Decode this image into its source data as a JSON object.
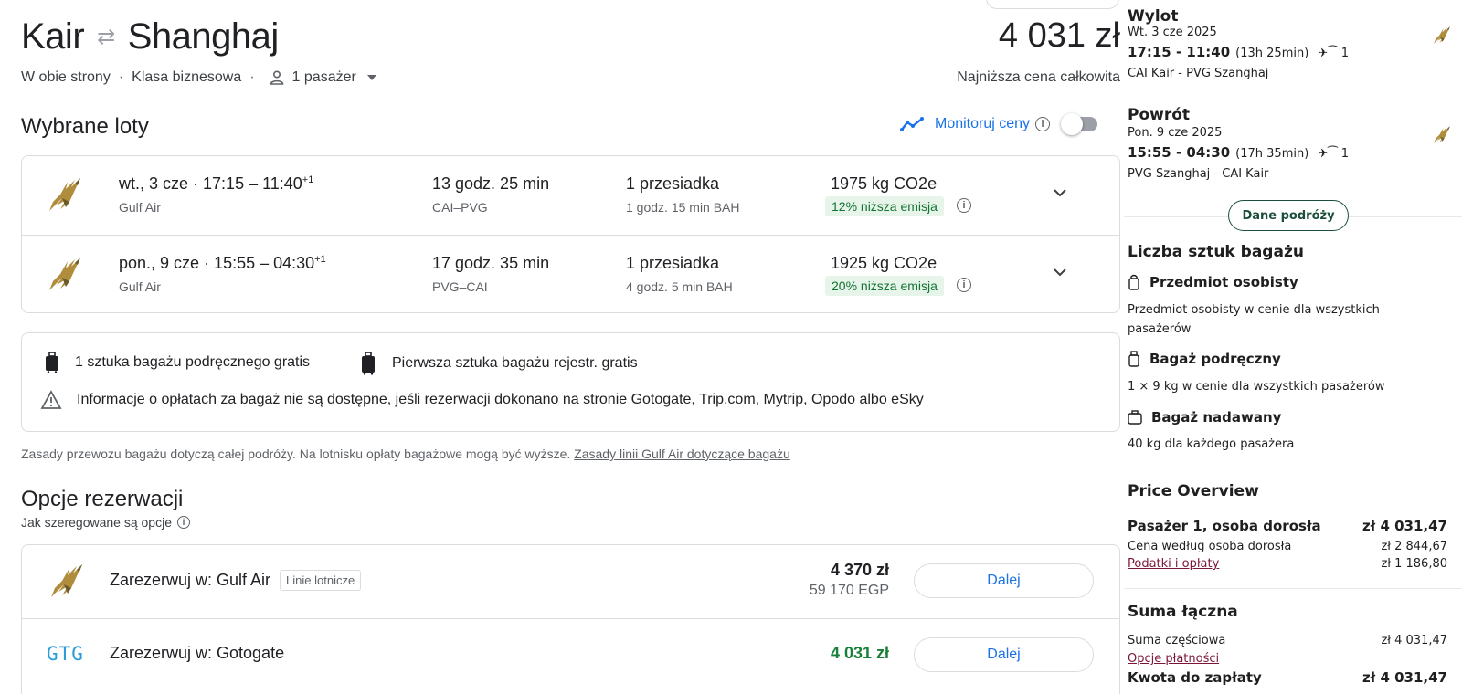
{
  "header": {
    "origin": "Kair",
    "destination": "Shanghaj",
    "total_price": "4 031 zł",
    "total_caption": "Najniższa cena całkowita",
    "trip_type": "W obie strony",
    "cabin": "Klasa biznesowa",
    "passengers": "1 pasażer"
  },
  "selected": {
    "title": "Wybrane loty",
    "monitor_label": "Monitoruj ceny",
    "flights": [
      {
        "date": "wt., 3 cze",
        "times": "17:15 – 11:40",
        "plus_day": "+1",
        "airline": "Gulf Air",
        "duration": "13 godz. 25 min",
        "route": "CAI–PVG",
        "stops": "1 przesiadka",
        "stop_info": "1 godz. 15 min BAH",
        "co2": "1975 kg CO2e",
        "emission": "12% niższa emisja"
      },
      {
        "date": "pon., 9 cze",
        "times": "15:55 – 04:30",
        "plus_day": "+1",
        "airline": "Gulf Air",
        "duration": "17 godz. 35 min",
        "route": "PVG–CAI",
        "stops": "1 przesiadka",
        "stop_info": "4 godz. 5 min BAH",
        "co2": "1925 kg CO2e",
        "emission": "20% niższa emisja"
      }
    ]
  },
  "baggage": {
    "carry_on": "1 sztuka bagażu podręcznego gratis",
    "checked": "Pierwsza sztuka bagażu rejestr. gratis",
    "warning": "Informacje o opłatach za bagaż nie są dostępne, jeśli rezerwacji dokonano na stronie Gotogate, Trip.com, Mytrip, Opodo albo eSky",
    "note": "Zasady przewozu bagażu dotyczą całej podróży. Na lotnisku opłaty bagażowe mogą być wyższe.",
    "note_link": "Zasady linii Gulf Air dotyczące bagażu"
  },
  "options": {
    "title": "Opcje rezerwacji",
    "subtitle": "Jak szeregowane są opcje",
    "rows": [
      {
        "name": "Zarezerwuj w: Gulf Air",
        "tag": "Linie lotnicze",
        "price": "4 370 zł",
        "alt_price": "59 170 EGP",
        "button": "Dalej"
      },
      {
        "name": "Zarezerwuj w: Gotogate",
        "logo_text": "GTG",
        "price": "4 031 zł",
        "button": "Dalej"
      }
    ]
  },
  "panel": {
    "outbound": {
      "head": "Wylot",
      "date": "Wt. 3 cze 2025",
      "times": "17:15 - 11:40",
      "duration": "(13h 25min)",
      "stops": "1",
      "route": "CAI Kair - PVG Szanghaj"
    },
    "inbound": {
      "head": "Powrót",
      "date": "Pon. 9 cze 2025",
      "times": "15:55 - 04:30",
      "duration": "(17h 35min)",
      "stops": "1",
      "route": "PVG Szanghaj - CAI Kair"
    },
    "details_button": "Dane podróży",
    "baggage_title": "Liczba sztuk bagażu",
    "personal_title": "Przedmiot osobisty",
    "personal_text": "Przedmiot osobisty w cenie dla wszystkich pasażerów",
    "carry_title": "Bagaż podręczny",
    "carry_text": "1 × 9 kg w cenie dla wszystkich pasażerów",
    "checked_title": "Bagaż nadawany",
    "checked_text": "40 kg dla każdego pasażera",
    "price_title": "Price Overview",
    "pax_label": "Pasażer 1, osoba dorosła",
    "pax_value": "zł 4 031,47",
    "fare_label": "Cena według osoba dorosła",
    "fare_value": "zł 2 844,67",
    "tax_label": "Podatki i opłaty",
    "tax_value": "zł 1 186,80",
    "sum_title": "Suma łączna",
    "subtotal_label": "Suma częściowa",
    "subtotal_value": "zł 4 031,47",
    "pay_label": "Opcje płatności",
    "due_label": "Kwota do zapłaty",
    "due_value": "zł 4 031,47"
  },
  "colors": {
    "accent": "#1a73e8",
    "green": "#188038",
    "badge_bg": "#e6f4ea",
    "panel_link": "#7b1638",
    "panel_button": "#1c4f3a"
  }
}
